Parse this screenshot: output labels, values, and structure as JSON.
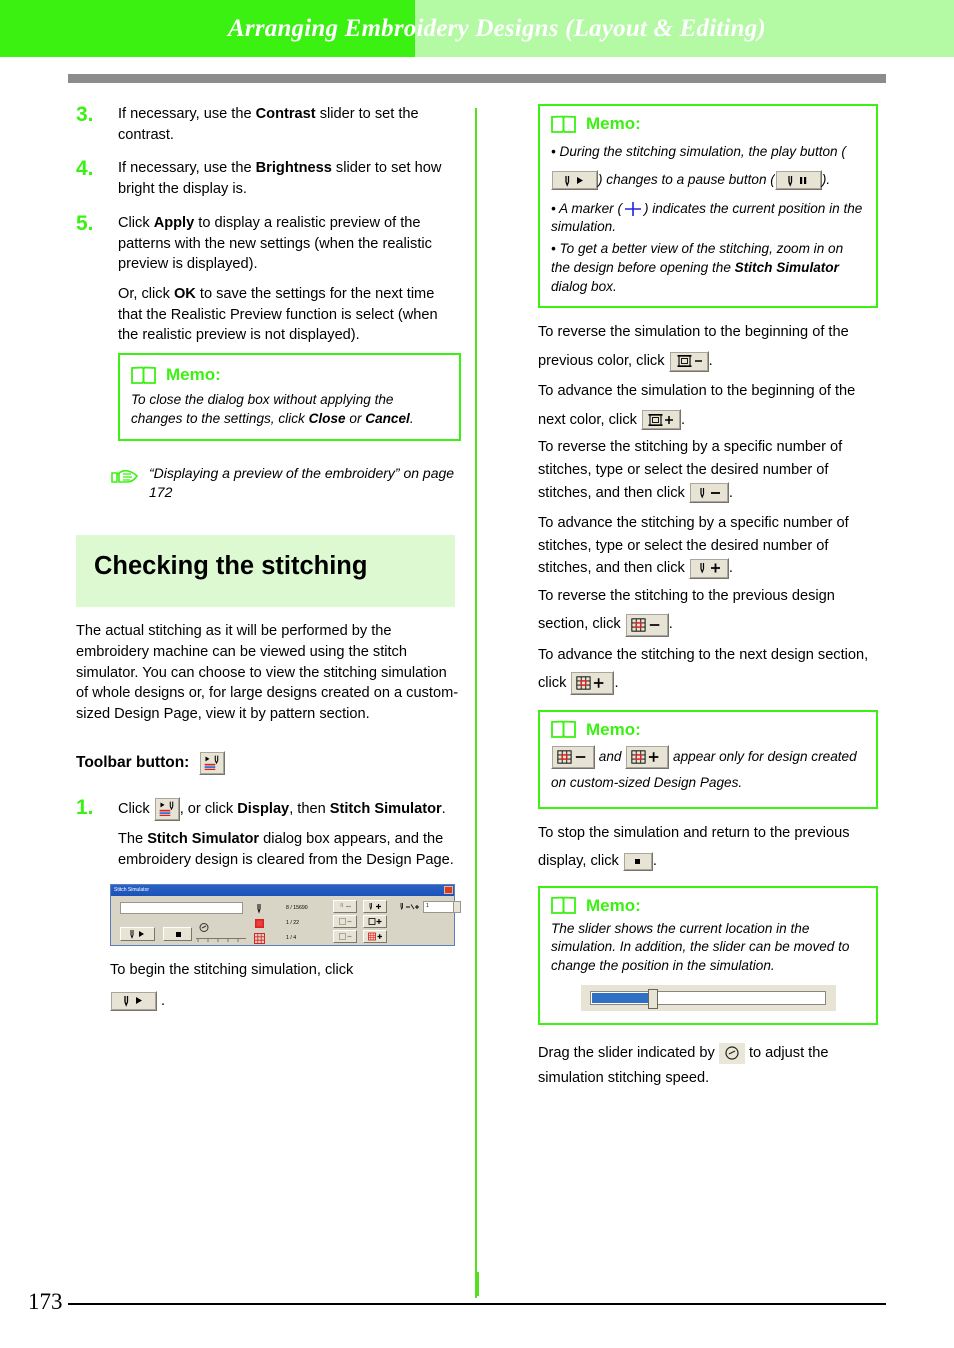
{
  "header": {
    "title": "Arranging Embroidery Designs (Layout & Editing)",
    "band_dark_color": "#3bf112",
    "band_light_color": "#b4f9a4",
    "rule_color": "#8c8c8c"
  },
  "footer": {
    "page_number": "173"
  },
  "left": {
    "steps": [
      {
        "num": "3.",
        "parts": [
          {
            "t": "If necessary, use the "
          },
          {
            "t": "Contrast",
            "b": true
          },
          {
            "t": " slider to set the contrast."
          }
        ]
      },
      {
        "num": "4.",
        "parts": [
          {
            "t": "If necessary, use the "
          },
          {
            "t": "Brightness",
            "b": true
          },
          {
            "t": " slider to set how bright the display is."
          }
        ]
      }
    ],
    "step5": {
      "num": "5.",
      "p1_a": "Click ",
      "p1_b": "Apply",
      "p1_c": " to display a realistic preview of the patterns with the new settings (when the realistic preview is displayed).",
      "p2_a": "Or, click ",
      "p2_b": "OK",
      "p2_c": " to save the settings for the next time that the Realistic Preview function is select (when the realistic preview is not displayed)."
    },
    "memo1": {
      "title": "Memo:",
      "a": "To close the dialog box without applying the changes to the settings, click ",
      "b": "Close",
      "c": " or ",
      "d": "Cancel",
      "e": "."
    },
    "reference": "“Displaying a preview of the embroidery” on page 172",
    "section_title": "Checking the stitching",
    "intro": "The actual stitching as it will be performed by the embroidery machine can be viewed using the stitch simulator. You can choose to view the stitching simulation of whole designs or, for large designs created on a custom-sized Design Page, view it by pattern section.",
    "toolbar_label": "Toolbar button:",
    "step1": {
      "num": "1.",
      "a": "Click ",
      "b": ", or click ",
      "c": "Display",
      "d": ", then ",
      "e": "Stitch Simulator",
      "f": ".",
      "g_a": "The ",
      "g_b": "Stitch Simulator",
      "g_c": " dialog box appears, and the embroidery design is cleared from the Design Page."
    },
    "dialog": {
      "title": "Stitch Simulator",
      "counter_stitch": "8 / 15690",
      "counter_color": "1 / 22",
      "counter_section": "1 / 4",
      "spin_value": "1"
    },
    "begin_text": "To begin the stitching simulation, click",
    "begin_period": "."
  },
  "right": {
    "memo1": {
      "title": "Memo:",
      "b1_a": "During the stitching simulation, the play button (",
      "b1_b": ") changes to a pause button (",
      "b1_c": ").",
      "b2_a": "A marker (",
      "b2_b": ") indicates the current position in the simulation.",
      "b3_a": "To get a better view of the stitching, zoom in on the design before opening the ",
      "b3_b": "Stitch Simulator",
      "b3_c": " dialog box."
    },
    "instructions": [
      {
        "a": "To reverse the simulation to the beginning of the previous color, click ",
        "icon": "spool-minus",
        "b": "."
      },
      {
        "a": "To advance the simulation to the beginning of the next color, click ",
        "icon": "spool-plus",
        "b": "."
      },
      {
        "a": "To reverse the stitching by a specific number of stitches, type or select the desired number of stitches, and then click ",
        "icon": "needle-minus",
        "b": "."
      },
      {
        "a": "To advance the stitching by a specific number of stitches, type or select the desired number of stitches, and then click ",
        "icon": "needle-plus",
        "b": "."
      },
      {
        "a": "To reverse the stitching to the previous design section, click ",
        "icon": "grid-minus",
        "b": "."
      },
      {
        "a": "To advance the stitching to the next design section, click ",
        "icon": "grid-plus",
        "b": "."
      }
    ],
    "memo2": {
      "title": "Memo:",
      "a": " and ",
      "b": " appear only for design created on custom-sized Design Pages."
    },
    "stop_text_a": "To stop the simulation and return to the previous display, click ",
    "stop_text_b": ".",
    "memo3": {
      "title": "Memo:",
      "body": "The slider shows the current location in the simulation. In addition, the slider can be moved to change the position in the simulation."
    },
    "drag_a": "Drag the slider indicated by ",
    "drag_b": " to adjust the simulation stitching speed."
  },
  "colors": {
    "accent_green": "#3bf112",
    "light_green": "#ddf9d2",
    "btn_face": "#e8e4d5",
    "marker_blue": "#2222dd",
    "slider_blue": "#2f6fc4",
    "icon_red": "#e02020"
  }
}
